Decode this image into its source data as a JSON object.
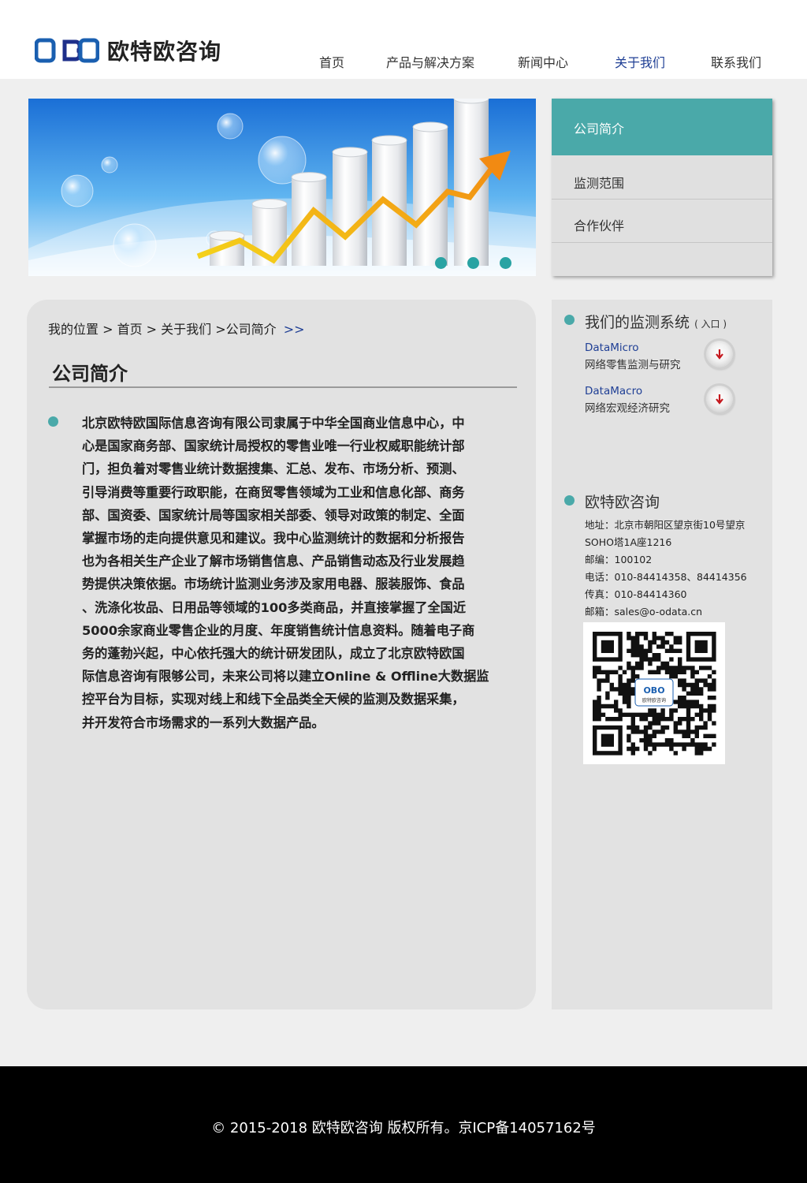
{
  "header": {
    "logo_mark": "OBO",
    "logo_text": "欧特欧咨询",
    "nav": [
      "首页",
      "产品与解决方案",
      "新闻中心",
      "关于我们",
      "联系我们"
    ],
    "nav_active": "关于我们"
  },
  "side_menu": {
    "items": [
      "公司简介",
      "监测范围",
      "合作伙伴"
    ],
    "active": "公司简介"
  },
  "banner": {
    "dots": 3,
    "bars": [
      0.18,
      0.37,
      0.53,
      0.68,
      0.75,
      0.83,
      1.0
    ]
  },
  "main": {
    "breadcrumb": "我的位置 > 首页 > 关于我们 >公司简介",
    "breadcrumb_arrow": ">>",
    "title": "公司简介",
    "intro_lines": [
      "北京欧特欧国际信息咨询有限公司隶属于中华全国商业信息中心，中",
      "心是国家商务部、国家统计局授权的零售业唯一行业权威职能统计部",
      "门，担负着对零售业统计数据搜集、汇总、发布、市场分析、预测、",
      "引导消费等重要行政职能，在商贸零售领域为工业和信息化部、商务",
      "部、国资委、国家统计局等国家相关部委、领导对政策的制定、全面",
      "掌握市场的走向提供意见和建议。我中心监测统计的数据和分析报告",
      "也为各相关生产企业了解市场销售信息、产品销售动态及行业发展趋",
      "势提供决策依据。市场统计监测业务涉及家用电器、服装服饰、食品",
      "、洗涤化妆品、日用品等领域的100多类商品，并直接掌握了全国近",
      "5000余家商业零售企业的月度、年度销售统计信息资料。随着电子商",
      "务的蓬勃兴起，中心依托强大的统计研发团队，成立了北京欧特欧国",
      "际信息咨询有限够公司，未来公司将以建立Online & Offline大数据监",
      "控平台为目标，实现对线上和线下全品类全天候的监测及数据采集，",
      "并开发符合市场需求的一系列大数据产品。"
    ]
  },
  "aside": {
    "systems_title": "我们的监测系统",
    "systems_title_suffix": "( 入口 )",
    "systems": [
      {
        "name": "DataMicro",
        "desc": "网络零售监测与研究"
      },
      {
        "name": "DataMacro",
        "desc": "网络宏观经济研究"
      }
    ],
    "company_title": "欧特欧咨询",
    "contact": [
      "地址：北京市朝阳区望京街10号望京",
      "SOHO塔1A座1216",
      "邮编：100102",
      "电话：010-84414358、84414356",
      "传真：010-84414360",
      "邮箱：sales@o-odata.cn"
    ],
    "qr_caption": "欧特欧咨询"
  },
  "footer": {
    "copyright": "© 2015-2018 欧特欧咨询 版权所有。京ICP备14057162号"
  },
  "colors": {
    "accent": "#4aa9a9",
    "nav_active": "#1f3f95",
    "footer": "#000000",
    "panel": "#e2e2e2"
  }
}
